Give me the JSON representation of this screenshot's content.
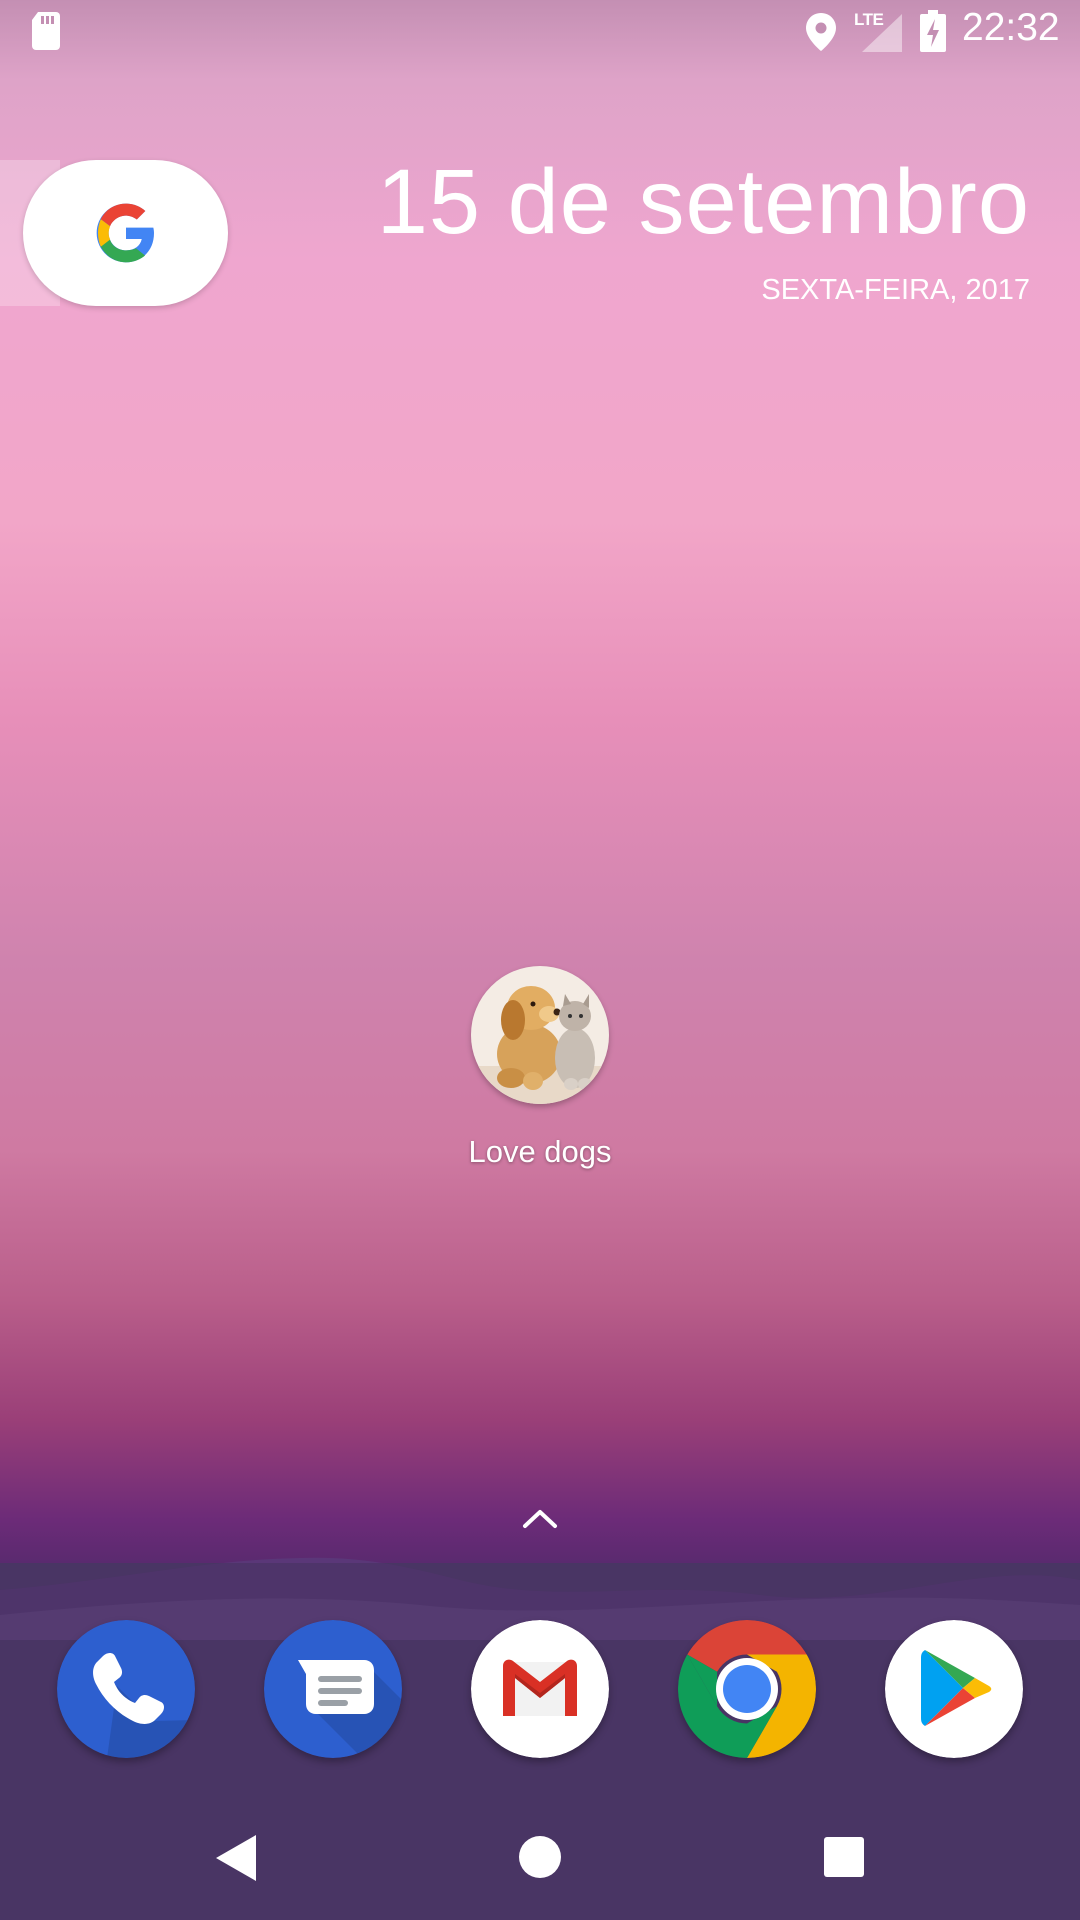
{
  "status_bar": {
    "time": "22:32",
    "network_label": "LTE",
    "icons": [
      "sd-card-icon",
      "location-icon",
      "signal-icon",
      "battery-charging-icon"
    ]
  },
  "google_search": {
    "icon": "google-g-icon"
  },
  "date_widget": {
    "date": "15 de setembro",
    "weekday_year": "SEXTA-FEIRA, 2017"
  },
  "home_apps": [
    {
      "label": "Love dogs",
      "icon": "puppy-kitten-photo-icon"
    }
  ],
  "app_drawer": {
    "icon": "chevron-up-icon"
  },
  "dock": [
    {
      "app": "phone",
      "icon": "phone-icon",
      "color": "#2d5fcf"
    },
    {
      "app": "messages",
      "icon": "messages-icon",
      "color": "#2d5fcf"
    },
    {
      "app": "gmail",
      "icon": "gmail-icon",
      "color": "#d93025"
    },
    {
      "app": "chrome",
      "icon": "chrome-icon",
      "color": "#4285f4"
    },
    {
      "app": "play-store",
      "icon": "play-store-icon",
      "color": "#00a173"
    }
  ],
  "nav_bar": {
    "icons": [
      "back-icon",
      "home-icon",
      "recents-icon"
    ]
  }
}
